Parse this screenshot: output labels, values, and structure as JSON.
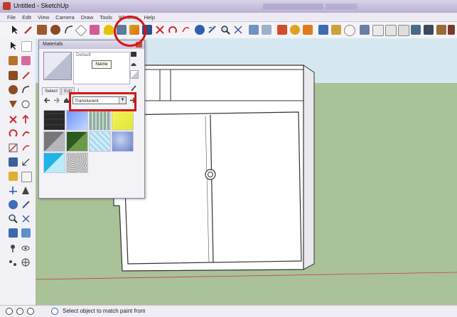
{
  "window": {
    "title": "Untitled - SketchUp"
  },
  "menu": [
    "File",
    "Edit",
    "View",
    "Camera",
    "Draw",
    "Tools",
    "Window",
    "Help"
  ],
  "toolbar": {
    "icons": [
      "select-icon",
      "pencil-icon",
      "rectangle-icon",
      "circle-icon",
      "arc-icon",
      "eraser-icon",
      "tape-icon",
      "paint-bucket-icon",
      "push-pull-icon",
      "move-icon",
      "rotate-icon",
      "follow-me-icon",
      "offset-icon",
      "dimension-icon",
      "text-icon",
      "axes-icon",
      "section-icon",
      "orbit-icon",
      "pan-icon",
      "zoom-icon",
      "zoom-extents-icon",
      "walk-icon",
      "look-around-icon",
      "camera-icon",
      "shadows-icon",
      "fog-icon",
      "iso-view-icon",
      "top-view-icon",
      "front-view-icon",
      "right-view-icon",
      "back-view-icon",
      "left-view-icon",
      "xray-icon",
      "wireframe-icon"
    ]
  },
  "materials_panel": {
    "title": "Materials",
    "default_label": "Default",
    "name_button": "Name",
    "tabs": [
      "Select",
      "Edit",
      "|"
    ],
    "library": "Translucent",
    "swatch_colors": [
      "#6f6f6f",
      "#6d93ff",
      "#9db8b0",
      "#e8ee49",
      "#8d8f95",
      "#3c6a2d",
      "#a9d9f2",
      "#7f95d8",
      "#2bbfe8",
      "#b5b5b5"
    ]
  },
  "status": {
    "text": "Select object to match paint from"
  },
  "annotations": {
    "highlight_color": "#d61515"
  }
}
